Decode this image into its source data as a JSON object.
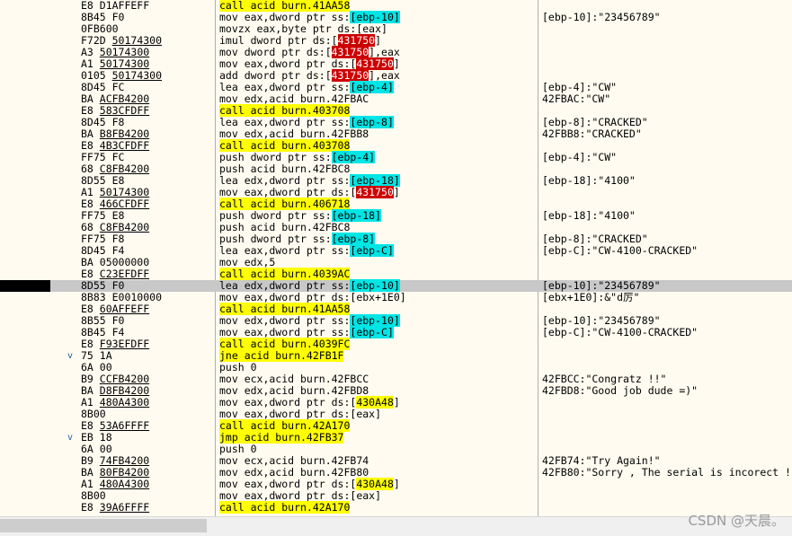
{
  "rows": [
    {
      "bytes": [
        {
          "t": "E8 D1AFFEFF"
        }
      ],
      "ins": [
        {
          "t": "call acid burn.41AA58",
          "c": "y"
        }
      ],
      "cmt": ""
    },
    {
      "bytes": [
        {
          "t": "8B45 F0"
        }
      ],
      "ins": [
        {
          "t": "mov eax,dword ptr ss:"
        },
        {
          "t": "[ebp-10]",
          "c": "c"
        }
      ],
      "cmt": "[ebp-10]:\"23456789\""
    },
    {
      "bytes": [
        {
          "t": "0FB600"
        }
      ],
      "ins": [
        {
          "t": "movzx eax,byte ptr ds:[eax]"
        }
      ],
      "cmt": ""
    },
    {
      "bytes": [
        {
          "t": "F72D "
        },
        {
          "t": "50174300",
          "u": true
        }
      ],
      "ins": [
        {
          "t": "imul dword ptr ds:["
        },
        {
          "t": "431750",
          "c": "r"
        },
        {
          "t": "]"
        }
      ],
      "cmt": ""
    },
    {
      "bytes": [
        {
          "t": "A3 "
        },
        {
          "t": "50174300",
          "u": true
        }
      ],
      "ins": [
        {
          "t": "mov dword ptr ds:["
        },
        {
          "t": "431750",
          "c": "r"
        },
        {
          "t": "],eax"
        }
      ],
      "cmt": ""
    },
    {
      "bytes": [
        {
          "t": "A1 "
        },
        {
          "t": "50174300",
          "u": true
        }
      ],
      "ins": [
        {
          "t": "mov eax,dword ptr ds:["
        },
        {
          "t": "431750",
          "c": "r"
        },
        {
          "t": "]"
        }
      ],
      "cmt": ""
    },
    {
      "bytes": [
        {
          "t": "0105 "
        },
        {
          "t": "50174300",
          "u": true
        }
      ],
      "ins": [
        {
          "t": "add dword ptr ds:["
        },
        {
          "t": "431750",
          "c": "r"
        },
        {
          "t": "],eax"
        }
      ],
      "cmt": ""
    },
    {
      "bytes": [
        {
          "t": "8D45 FC"
        }
      ],
      "ins": [
        {
          "t": "lea eax,dword ptr ss:"
        },
        {
          "t": "[ebp-4]",
          "c": "c"
        }
      ],
      "cmt": "[ebp-4]:\"CW\""
    },
    {
      "bytes": [
        {
          "t": "BA "
        },
        {
          "t": "ACFB4200",
          "u": true
        }
      ],
      "ins": [
        {
          "t": "mov edx,acid burn.42FBAC"
        }
      ],
      "cmt": "42FBAC:\"CW\""
    },
    {
      "bytes": [
        {
          "t": "E8 "
        },
        {
          "t": "583CFDFF",
          "u": true
        }
      ],
      "ins": [
        {
          "t": "call acid burn.403708",
          "c": "y"
        }
      ],
      "cmt": ""
    },
    {
      "bytes": [
        {
          "t": "8D45 F8"
        }
      ],
      "ins": [
        {
          "t": "lea eax,dword ptr ss:"
        },
        {
          "t": "[ebp-8]",
          "c": "c"
        }
      ],
      "cmt": "[ebp-8]:\"CRACKED\""
    },
    {
      "bytes": [
        {
          "t": "BA "
        },
        {
          "t": "B8FB4200",
          "u": true
        }
      ],
      "ins": [
        {
          "t": "mov edx,acid burn.42FBB8"
        }
      ],
      "cmt": "42FBB8:\"CRACKED\""
    },
    {
      "bytes": [
        {
          "t": "E8 "
        },
        {
          "t": "4B3CFDFF",
          "u": true
        }
      ],
      "ins": [
        {
          "t": "call acid burn.403708",
          "c": "y"
        }
      ],
      "cmt": ""
    },
    {
      "bytes": [
        {
          "t": "FF75 FC"
        }
      ],
      "ins": [
        {
          "t": "push dword ptr ss:"
        },
        {
          "t": "[ebp-4]",
          "c": "c"
        }
      ],
      "cmt": "[ebp-4]:\"CW\""
    },
    {
      "bytes": [
        {
          "t": "68 "
        },
        {
          "t": "C8FB4200",
          "u": true
        }
      ],
      "ins": [
        {
          "t": "push acid burn.42FBC8"
        }
      ],
      "cmt": ""
    },
    {
      "bytes": [
        {
          "t": "8D55 E8"
        }
      ],
      "ins": [
        {
          "t": "lea edx,dword ptr ss:"
        },
        {
          "t": "[ebp-18]",
          "c": "c"
        }
      ],
      "cmt": "[ebp-18]:\"4100\""
    },
    {
      "bytes": [
        {
          "t": "A1 "
        },
        {
          "t": "50174300",
          "u": true
        }
      ],
      "ins": [
        {
          "t": "mov eax,dword ptr ds:["
        },
        {
          "t": "431750",
          "c": "r"
        },
        {
          "t": "]"
        }
      ],
      "cmt": ""
    },
    {
      "bytes": [
        {
          "t": "E8 "
        },
        {
          "t": "466CFDFF",
          "u": true
        }
      ],
      "ins": [
        {
          "t": "call acid burn.406718",
          "c": "y"
        }
      ],
      "cmt": ""
    },
    {
      "bytes": [
        {
          "t": "FF75 E8"
        }
      ],
      "ins": [
        {
          "t": "push dword ptr ss:"
        },
        {
          "t": "[ebp-18]",
          "c": "c"
        }
      ],
      "cmt": "[ebp-18]:\"4100\""
    },
    {
      "bytes": [
        {
          "t": "68 "
        },
        {
          "t": "C8FB4200",
          "u": true
        }
      ],
      "ins": [
        {
          "t": "push acid burn.42FBC8"
        }
      ],
      "cmt": ""
    },
    {
      "bytes": [
        {
          "t": "FF75 F8"
        }
      ],
      "ins": [
        {
          "t": "push dword ptr ss:"
        },
        {
          "t": "[ebp-8]",
          "c": "c"
        }
      ],
      "cmt": "[ebp-8]:\"CRACKED\""
    },
    {
      "bytes": [
        {
          "t": "8D45 F4"
        }
      ],
      "ins": [
        {
          "t": "lea eax,dword ptr ss:"
        },
        {
          "t": "[ebp-C]",
          "c": "c"
        }
      ],
      "cmt": "[ebp-C]:\"CW-4100-CRACKED\""
    },
    {
      "bytes": [
        {
          "t": "BA 05000000"
        }
      ],
      "ins": [
        {
          "t": "mov edx,5"
        }
      ],
      "cmt": ""
    },
    {
      "bytes": [
        {
          "t": "E8 "
        },
        {
          "t": "C23EFDFF",
          "u": true
        }
      ],
      "ins": [
        {
          "t": "call acid burn.4039AC",
          "c": "y"
        }
      ],
      "cmt": ""
    },
    {
      "bytes": [
        {
          "t": "8D55 F0"
        }
      ],
      "ins": [
        {
          "t": "lea edx,dword ptr ss:"
        },
        {
          "t": "[ebp-10]",
          "c": "c"
        }
      ],
      "cmt": "[ebp-10]:\"23456789\"",
      "hl": true
    },
    {
      "bytes": [
        {
          "t": "8B83 E0010000"
        }
      ],
      "ins": [
        {
          "t": "mov eax,dword ptr ds:[ebx+1E0]"
        }
      ],
      "cmt": "[ebx+1E0]:&\"d厉\""
    },
    {
      "bytes": [
        {
          "t": "E8 "
        },
        {
          "t": "60AFFEFF",
          "u": true
        }
      ],
      "ins": [
        {
          "t": "call acid burn.41AA58",
          "c": "y"
        }
      ],
      "cmt": ""
    },
    {
      "bytes": [
        {
          "t": "8B55 F0"
        }
      ],
      "ins": [
        {
          "t": "mov edx,dword ptr ss:"
        },
        {
          "t": "[ebp-10]",
          "c": "c"
        }
      ],
      "cmt": "[ebp-10]:\"23456789\""
    },
    {
      "bytes": [
        {
          "t": "8B45 F4"
        }
      ],
      "ins": [
        {
          "t": "mov eax,dword ptr ss:"
        },
        {
          "t": "[ebp-C]",
          "c": "c"
        }
      ],
      "cmt": "[ebp-C]:\"CW-4100-CRACKED\""
    },
    {
      "bytes": [
        {
          "t": "E8 "
        },
        {
          "t": "F93EFDFF",
          "u": true
        }
      ],
      "ins": [
        {
          "t": "call acid burn.4039FC",
          "c": "y"
        }
      ],
      "cmt": ""
    },
    {
      "arrow": "v",
      "bytes": [
        {
          "t": "75 1A"
        }
      ],
      "ins": [
        {
          "t": "jne acid burn.42FB1F",
          "c": "y"
        }
      ],
      "cmt": ""
    },
    {
      "bytes": [
        {
          "t": "6A 00"
        }
      ],
      "ins": [
        {
          "t": "push 0"
        }
      ],
      "cmt": ""
    },
    {
      "bytes": [
        {
          "t": "B9 "
        },
        {
          "t": "CCFB4200",
          "u": true
        }
      ],
      "ins": [
        {
          "t": "mov ecx,acid burn.42FBCC"
        }
      ],
      "cmt": "42FBCC:\"Congratz !!\""
    },
    {
      "bytes": [
        {
          "t": "BA "
        },
        {
          "t": "D8FB4200",
          "u": true
        }
      ],
      "ins": [
        {
          "t": "mov edx,acid burn.42FBD8"
        }
      ],
      "cmt": "42FBD8:\"Good job dude =)\""
    },
    {
      "bytes": [
        {
          "t": "A1 "
        },
        {
          "t": "480A4300",
          "u": true
        }
      ],
      "ins": [
        {
          "t": "mov eax,dword ptr ds:["
        },
        {
          "t": "430A48",
          "c": "y"
        },
        {
          "t": "]"
        }
      ],
      "cmt": ""
    },
    {
      "bytes": [
        {
          "t": "8B00"
        }
      ],
      "ins": [
        {
          "t": "mov eax,dword ptr ds:[eax]"
        }
      ],
      "cmt": ""
    },
    {
      "bytes": [
        {
          "t": "E8 "
        },
        {
          "t": "53A6FFFF",
          "u": true
        }
      ],
      "ins": [
        {
          "t": "call acid burn.42A170",
          "c": "y"
        }
      ],
      "cmt": ""
    },
    {
      "arrow": "v",
      "bytes": [
        {
          "t": "EB 18"
        }
      ],
      "ins": [
        {
          "t": "jmp acid burn.42FB37",
          "c": "y"
        }
      ],
      "cmt": ""
    },
    {
      "bytes": [
        {
          "t": "6A 00"
        }
      ],
      "ins": [
        {
          "t": "push 0"
        }
      ],
      "cmt": ""
    },
    {
      "bytes": [
        {
          "t": "B9 "
        },
        {
          "t": "74FB4200",
          "u": true
        }
      ],
      "ins": [
        {
          "t": "mov ecx,acid burn.42FB74"
        }
      ],
      "cmt": "42FB74:\"Try Again!\""
    },
    {
      "bytes": [
        {
          "t": "BA "
        },
        {
          "t": "80FB4200",
          "u": true
        }
      ],
      "ins": [
        {
          "t": "mov edx,acid burn.42FB80"
        }
      ],
      "cmt": "42FB80:\"Sorry , The serial is incorect !\""
    },
    {
      "bytes": [
        {
          "t": "A1 "
        },
        {
          "t": "480A4300",
          "u": true
        }
      ],
      "ins": [
        {
          "t": "mov eax,dword ptr ds:["
        },
        {
          "t": "430A48",
          "c": "y"
        },
        {
          "t": "]"
        }
      ],
      "cmt": ""
    },
    {
      "bytes": [
        {
          "t": "8B00"
        }
      ],
      "ins": [
        {
          "t": "mov eax,dword ptr ds:[eax]"
        }
      ],
      "cmt": ""
    },
    {
      "bytes": [
        {
          "t": "E8 "
        },
        {
          "t": "39A6FFFF",
          "u": true
        }
      ],
      "ins": [
        {
          "t": "call acid burn.42A170",
          "c": "y"
        }
      ],
      "cmt": ""
    }
  ],
  "watermark": "CSDN @天晨。"
}
